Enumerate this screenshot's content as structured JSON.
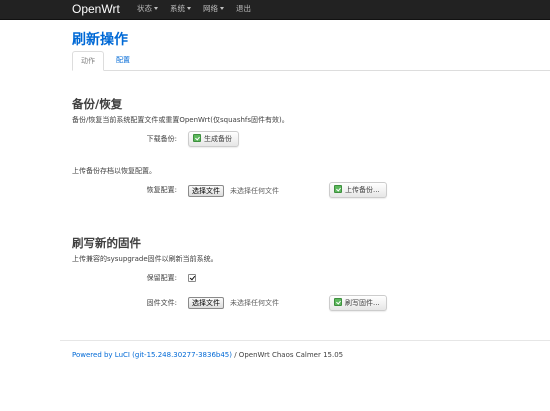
{
  "brand": "OpenWrt",
  "nav": {
    "status": "状态",
    "system": "系统",
    "network": "网络",
    "logout": "退出"
  },
  "page": {
    "title": "刷新操作",
    "tabs": {
      "actions": "动作",
      "config": "配置"
    }
  },
  "backup": {
    "title": "备份/恢复",
    "description": "备份/恢复当前系统配置文件或重置OpenWrt(仅squashfs固件有效)。",
    "download_label": "下载备份:",
    "generate_button": "生成备份",
    "upload_description": "上传备份存档以恢复配置。",
    "restore_label": "恢复配置:",
    "choose_file": "选择文件",
    "no_file": "未选择任何文件",
    "upload_button": "上传备份..."
  },
  "flash": {
    "title": "刷写新的固件",
    "description": "上传兼容的sysupgrade固件以刷新当前系统。",
    "keep_config_label": "保留配置:",
    "keep_config_checked": true,
    "image_label": "固件文件:",
    "choose_file": "选择文件",
    "no_file": "未选择任何文件",
    "flash_button": "刷写固件..."
  },
  "footer": {
    "link_text": "Powered by LuCI (git-15.248.30277-3836b45)",
    "version_text": " / OpenWrt Chaos Calmer 15.05"
  }
}
